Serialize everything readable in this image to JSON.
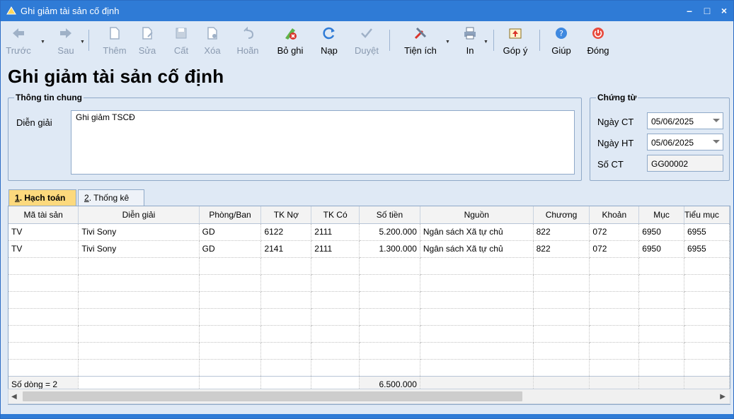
{
  "window": {
    "title": "Ghi giảm tài sản cố định",
    "minimize": "–",
    "maximize": "□",
    "close": "×"
  },
  "toolbar": {
    "buttons": [
      {
        "label": "Trước",
        "icon": "arrow-left-icon",
        "disabled": true
      },
      {
        "label": "Sau",
        "icon": "arrow-right-icon",
        "disabled": true
      },
      {
        "label": "Thêm",
        "icon": "new-document-icon",
        "disabled": true
      },
      {
        "label": "Sửa",
        "icon": "edit-document-icon",
        "disabled": true
      },
      {
        "label": "Cất",
        "icon": "save-icon",
        "disabled": true
      },
      {
        "label": "Xóa",
        "icon": "delete-document-icon",
        "disabled": true
      },
      {
        "label": "Hoãn",
        "icon": "undo-icon",
        "disabled": true
      },
      {
        "label": "Bỏ ghi",
        "icon": "unpost-icon",
        "disabled": false
      },
      {
        "label": "Nạp",
        "icon": "refresh-icon",
        "disabled": false
      },
      {
        "label": "Duyệt",
        "icon": "checkmark-icon",
        "disabled": true
      },
      {
        "label": "Tiện ích",
        "icon": "tools-icon",
        "disabled": false
      },
      {
        "label": "In",
        "icon": "printer-icon",
        "disabled": false
      },
      {
        "label": "Góp ý",
        "icon": "feedback-icon",
        "disabled": false
      },
      {
        "label": "Giúp",
        "icon": "help-icon",
        "disabled": false
      },
      {
        "label": "Đóng",
        "icon": "power-icon",
        "disabled": false
      }
    ]
  },
  "page_title": "Ghi giảm tài sản cố định",
  "general_info": {
    "title": "Thông tin chung",
    "description_label": "Diễn giải",
    "description_value": "Ghi giảm TSCĐ"
  },
  "voucher": {
    "title": "Chứng từ",
    "date_ct_label": "Ngày CT",
    "date_ct_value": "05/06/2025",
    "date_ht_label": "Ngày HT",
    "date_ht_value": "05/06/2025",
    "number_label": "Số CT",
    "number_value": "GG00002"
  },
  "tabs": [
    {
      "key": "1",
      "label": ". Hạch toán"
    },
    {
      "key": "2",
      "label": ". Thống kê"
    }
  ],
  "grid": {
    "columns": [
      "Mã tài sản",
      "Diễn giải",
      "Phòng/Ban",
      "TK Nợ",
      "TK Có",
      "Số tiền",
      "Nguồn",
      "Chương",
      "Khoản",
      "Mục",
      "Tiểu mục"
    ],
    "rows": [
      [
        "TV",
        "Tivi Sony",
        "GD",
        "6122",
        "2111",
        "5.200.000",
        "Ngân sách Xã tự chủ",
        "822",
        "072",
        "6950",
        "6955"
      ],
      [
        "TV",
        "Tivi Sony",
        "GD",
        "2141",
        "2111",
        "1.300.000",
        "Ngân sách Xã tự chủ",
        "822",
        "072",
        "6950",
        "6955"
      ]
    ],
    "footer_count": "Số dòng = 2",
    "footer_total": "6.500.000"
  },
  "colors": {
    "titlebar": "#2f7bd6",
    "background": "#dfe9f5",
    "active_tab": "#fcd97d"
  }
}
